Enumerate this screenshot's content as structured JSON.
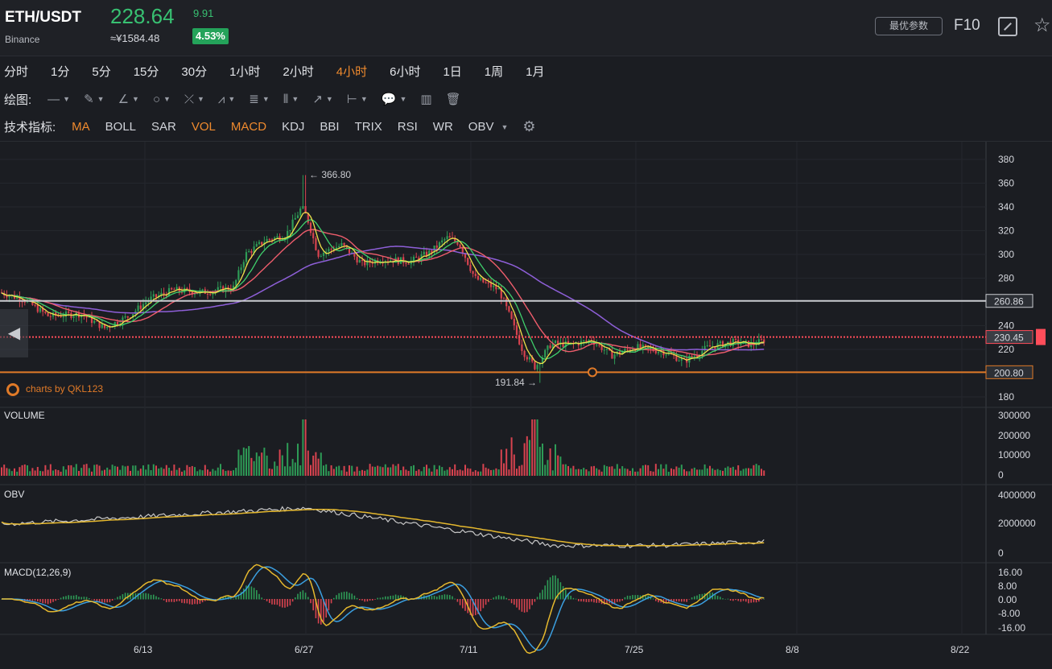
{
  "header": {
    "symbol": "ETH/USDT",
    "exchange": "Binance",
    "price": "228.64",
    "cny_price": "≈¥1584.48",
    "change": "9.91",
    "change_pct": "4.53%",
    "params_button": "最优参数",
    "f10_button": "F10",
    "expand_icon": "expand-icon",
    "star_icon": "star-icon"
  },
  "periods": {
    "items": [
      "分时",
      "1分",
      "5分",
      "15分",
      "30分",
      "1小时",
      "2小时",
      "4小时",
      "6小时",
      "1日",
      "1周",
      "1月"
    ],
    "active": "4小时"
  },
  "draw_tools": {
    "label": "绘图:",
    "tools": [
      "line",
      "pencil",
      "angle-line",
      "circle",
      "cross",
      "pattern",
      "channel",
      "parallel",
      "arrow",
      "range",
      "comment",
      "bars",
      "trash"
    ]
  },
  "indicators": {
    "label": "技术指标:",
    "items": [
      "MA",
      "BOLL",
      "SAR",
      "VOL",
      "MACD",
      "KDJ",
      "BBI",
      "TRIX",
      "RSI",
      "WR",
      "OBV"
    ],
    "active": [
      "MA",
      "VOL",
      "MACD"
    ],
    "dropdown_icon": "caret-down-icon",
    "settings_icon": "gear-icon"
  },
  "watermark": "charts by QKL123",
  "panes": {
    "volume": "VOLUME",
    "obv": "OBV",
    "macd": "MACD(12,26,9)"
  },
  "chart_data": {
    "type": "candlestick",
    "price_axis": [
      380,
      360,
      340,
      320,
      300,
      280,
      240,
      220,
      180
    ],
    "volume_axis": [
      "300000",
      "200000",
      "100000",
      "0"
    ],
    "obv_axis": [
      "4000000",
      "2000000",
      "0"
    ],
    "macd_axis": [
      "16.00",
      "8.00",
      "0.00",
      "-8.00",
      "-16.00"
    ],
    "x_axis": [
      "6/13",
      "6/27",
      "7/11",
      "7/25",
      "8/8",
      "8/22"
    ],
    "high_label": "366.80",
    "low_label": "191.84",
    "price_lines": [
      {
        "label": "260.86",
        "value": 260.86,
        "color": "#c9cbd0"
      },
      {
        "label": "230.45",
        "value": 230.45,
        "color": "#ff4d5a"
      },
      {
        "label": "200.80",
        "value": 200.8,
        "color": "#e07a28"
      }
    ],
    "colors": {
      "up": "#2e9b56",
      "down": "#d8434f",
      "ma5": "#f0e04a",
      "ma10": "#3fd06c",
      "ma20": "#ee5d6c",
      "ma60": "#8e5fd8",
      "obv": "#c8c8c8",
      "obv_ma": "#e5b82e",
      "dif": "#e5b82e",
      "dea": "#3b9fe0"
    }
  }
}
